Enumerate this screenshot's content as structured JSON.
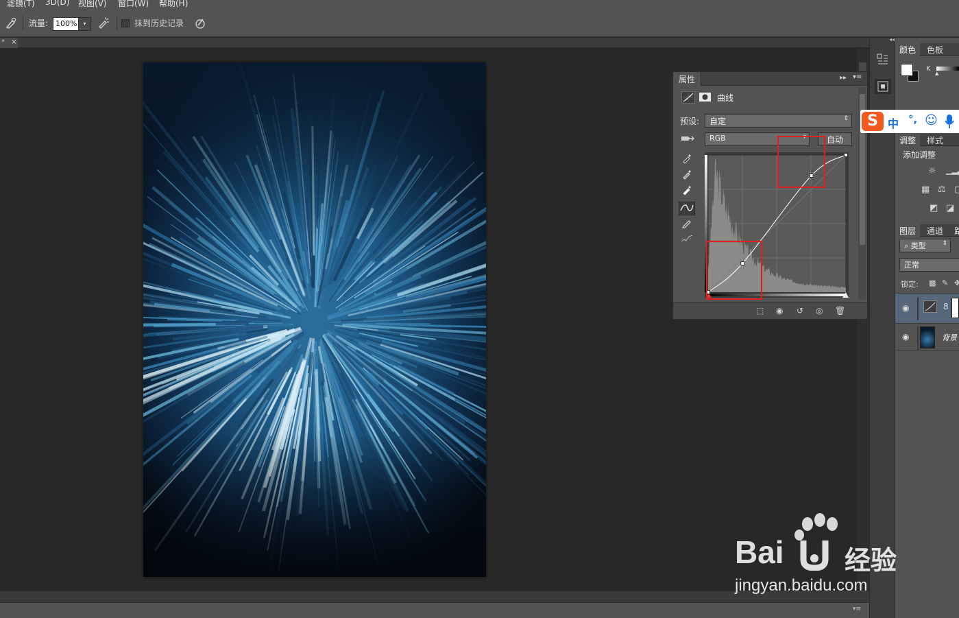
{
  "menubar": {
    "items": [
      "滤镜(T)",
      "3D(D)",
      "视图(V)",
      "窗口(W)",
      "帮助(H)"
    ]
  },
  "options": {
    "flow_label": "流量:",
    "flow_value": "100%",
    "history_label": "抹到历史记录"
  },
  "document": {
    "tab_close": "×"
  },
  "properties": {
    "tab_label": "属性",
    "title": "曲线",
    "preset_label": "预设:",
    "preset_value": "自定",
    "channel_value": "RGB",
    "auto_label": "自动",
    "curve_points": [
      [
        0,
        0
      ],
      [
        0.25,
        0.21
      ],
      [
        0.75,
        0.85
      ],
      [
        1,
        1
      ]
    ]
  },
  "dock": {
    "color_tabs": [
      "颜色",
      "色板"
    ],
    "color_channel_label": "K",
    "adjust_tabs": [
      "调整",
      "样式"
    ],
    "add_adjustment_label": "添加调整",
    "layers_tabs": [
      "图层",
      "通道",
      "路"
    ],
    "filter_kind_label": "类型",
    "blend_mode": "正常",
    "lock_label": "锁定:",
    "layer_background_name": "背景"
  },
  "ime": {
    "mode_label": "中",
    "punct_label": "°,"
  },
  "watermark": {
    "brand": "Bai",
    "brand_suffix": "经验",
    "url": "jingyan.baidu.com"
  }
}
